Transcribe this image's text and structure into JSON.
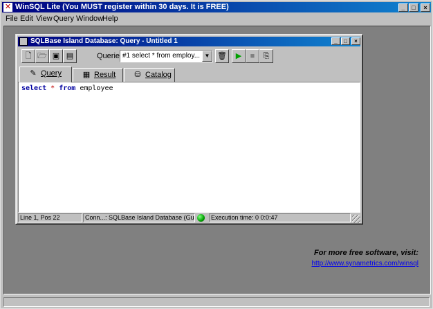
{
  "app": {
    "title": "WinSQL Lite (You MUST register within 30 days. It is FREE)",
    "menu": [
      "File",
      "Edit",
      "View",
      "Query",
      "Window",
      "Help"
    ],
    "caption_buttons": {
      "minimize": "_",
      "maximize": "□",
      "close": "×"
    }
  },
  "promo": {
    "text": "For more free software, visit:",
    "link": "http://www.synametrics.com/winsql"
  },
  "child": {
    "title": "SQLBase Island Database: Query - Untitled 1",
    "caption_buttons": {
      "minimize": "_",
      "maximize": "□",
      "close": "×"
    },
    "toolbar": {
      "queries_label": "Queries:",
      "queries_value": "#1 select * from employ..."
    },
    "tabs": [
      {
        "label": "Query",
        "icon": "pencil-icon",
        "active": true
      },
      {
        "label": "Result",
        "icon": "result-icon",
        "active": false
      },
      {
        "label": "Catalog",
        "icon": "catalog-icon",
        "active": false
      }
    ],
    "editor": {
      "keyword1": "select",
      "operator": "*",
      "keyword2": "from",
      "table": "employee"
    },
    "status": {
      "position": "Line 1, Pos 22",
      "connection": "Conn...: SQLBase Island Database (Gupta SQLBase)",
      "execution": "Execution time: 0 0:0:47",
      "status_color": "#00a000"
    }
  }
}
